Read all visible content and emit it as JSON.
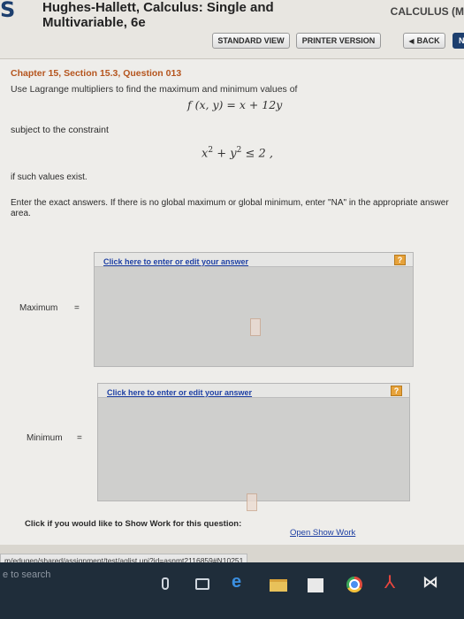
{
  "header": {
    "logo": "S",
    "book_title_line1": "Hughes-Hallett, Calculus: Single and",
    "book_title_line2": "Multivariable, 6e",
    "brand": "CALCULUS (M"
  },
  "toolbar": {
    "standard_view": "STANDARD VIEW",
    "printer_version": "PRINTER VERSION",
    "back": "BACK",
    "back_chevron": "◀",
    "next_partial": "N"
  },
  "question": {
    "title": "Chapter 15, Section 15.3, Question 013",
    "instruction": "Use Lagrange multipliers to find the maximum and minimum values of",
    "function": "f (x, y) = x + 12y",
    "constraint_label": "subject to the constraint",
    "constraint_x": "x",
    "constraint_exp1": "2",
    "constraint_plus": " + y",
    "constraint_exp2": "2",
    "constraint_rhs": " ≤ 2 ,",
    "exists": "if such values exist.",
    "exact_note": "Enter the exact answers. If there is no global maximum or global minimum, enter \"NA\" in the appropriate answer area."
  },
  "answers": {
    "click_link": "Click here to enter or edit your answer",
    "help": "?",
    "maximum_label": "Maximum",
    "minimum_label": "Minimum",
    "equals": "="
  },
  "show_work": {
    "prompt": "Click if you would like to Show Work for this question:",
    "link": "Open Show Work"
  },
  "status": {
    "url": "m/edugen/shared/assignment/test/aglist.uni?id=asnmt2116859#N10251"
  },
  "taskbar": {
    "search": "e to search"
  }
}
